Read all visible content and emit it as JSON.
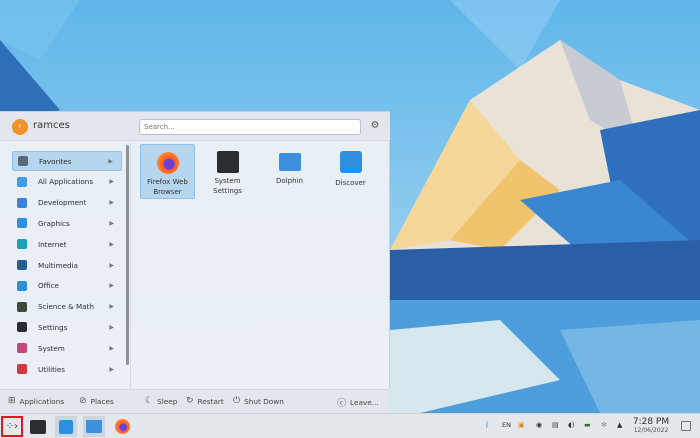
{
  "menu": {
    "user": "ramces",
    "avatar_letter": "r",
    "search_placeholder": "Search...",
    "categories": [
      {
        "label": "Favorites",
        "color": "#5a6a7a"
      },
      {
        "label": "All Applications",
        "color": "#3d9be9"
      },
      {
        "label": "Development",
        "color": "#3a7fd8"
      },
      {
        "label": "Graphics",
        "color": "#2e8ee0"
      },
      {
        "label": "Internet",
        "color": "#1aa2b8"
      },
      {
        "label": "Multimedia",
        "color": "#2a5d8f"
      },
      {
        "label": "Office",
        "color": "#2d8fd8"
      },
      {
        "label": "Science & Math",
        "color": "#3d4a3d"
      },
      {
        "label": "Settings",
        "color": "#2a2e32"
      },
      {
        "label": "System",
        "color": "#c24a7a"
      },
      {
        "label": "Utilities",
        "color": "#d0393f"
      }
    ],
    "favorites": [
      {
        "label": "Firefox Web Browser"
      },
      {
        "label": "System Settings"
      },
      {
        "label": "Dolphin"
      },
      {
        "label": "Discover"
      }
    ],
    "footer": {
      "applications": "Applications",
      "places": "Places",
      "sleep": "Sleep",
      "restart": "Restart",
      "shutdown": "Shut Down",
      "leave": "Leave..."
    }
  },
  "taskbar": {
    "lang": "EN",
    "time": "7:28 PM",
    "date": "12/06/2022"
  }
}
